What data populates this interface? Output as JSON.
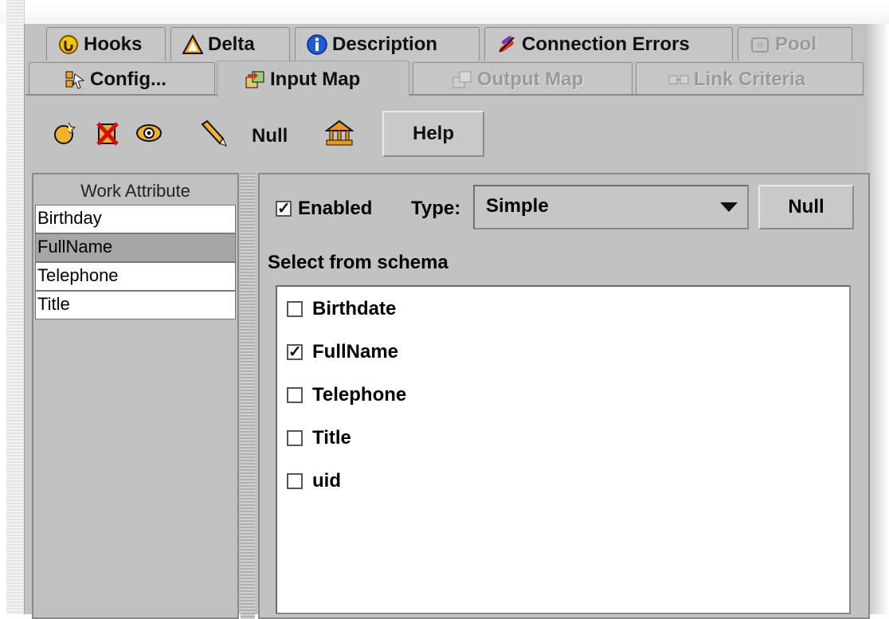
{
  "tabs_row1": [
    {
      "label": "Hooks",
      "icon": "hook-icon",
      "state": "normal"
    },
    {
      "label": "Delta",
      "icon": "warning-triangle-icon",
      "state": "normal"
    },
    {
      "label": "Description",
      "icon": "info-icon",
      "state": "normal"
    },
    {
      "label": "Connection Errors",
      "icon": "broken-connection-icon",
      "state": "normal"
    },
    {
      "label": "Pool",
      "icon": "pool-icon",
      "state": "disabled"
    }
  ],
  "tabs_row2": [
    {
      "label": "Config...",
      "icon": "config-icon",
      "state": "normal"
    },
    {
      "label": "Input Map",
      "icon": "input-map-icon",
      "state": "active"
    },
    {
      "label": "Output Map",
      "icon": "output-map-icon",
      "state": "disabled"
    },
    {
      "label": "Link Criteria",
      "icon": "link-criteria-icon",
      "state": "disabled"
    }
  ],
  "toolbar": {
    "icons": [
      "add-attribute-icon",
      "delete-attribute-icon",
      "view-icon",
      "edit-pencil-icon"
    ],
    "null_label": "Null",
    "extra_icon": "schema-icon",
    "help_label": "Help"
  },
  "work_attributes": {
    "header": "Work Attribute",
    "items": [
      {
        "label": "Birthday",
        "selected": false
      },
      {
        "label": "FullName",
        "selected": true
      },
      {
        "label": "Telephone",
        "selected": false
      },
      {
        "label": "Title",
        "selected": false
      }
    ]
  },
  "mapping": {
    "enabled_label": "Enabled",
    "enabled_checked": true,
    "type_label": "Type:",
    "type_value": "Simple",
    "null_button": "Null",
    "schema_label": "Select from schema",
    "schema_items": [
      {
        "label": "Birthdate",
        "checked": false
      },
      {
        "label": "FullName",
        "checked": true
      },
      {
        "label": "Telephone",
        "checked": false
      },
      {
        "label": "Title",
        "checked": false
      },
      {
        "label": "uid",
        "checked": false
      }
    ]
  },
  "colors": {
    "panel_bg": "#c2c2c2",
    "selected_row": "#a6a6a6",
    "info_blue": "#1e5bd6",
    "warning_orange": "#e8a317"
  }
}
